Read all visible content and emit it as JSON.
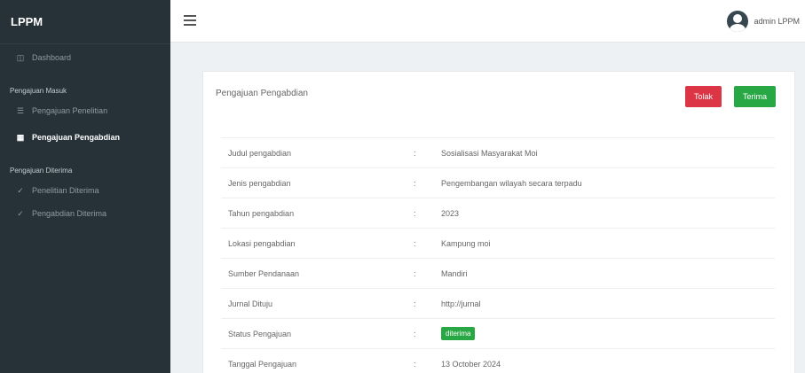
{
  "sidebar": {
    "brand": "LPPM",
    "dashboard": "Dashboard",
    "section_incoming": "Pengajuan Masuk",
    "item_research": "Pengajuan Penelitian",
    "item_service": "Pengajuan Pengabdian",
    "section_accepted": "Pengajuan Diterima",
    "item_research_accepted": "Penelitian Diterima",
    "item_service_accepted": "Pengabdian Diterima"
  },
  "header": {
    "user_name": "admin LPPM"
  },
  "card": {
    "title": "Pengajuan Pengabdian",
    "reject_label": "Tolak",
    "accept_label": "Terima",
    "separator": ":",
    "fields": [
      {
        "label": "Judul pengabdian",
        "value": "Sosialisasi Masyarakat Moi"
      },
      {
        "label": "Jenis pengabdian",
        "value": "Pengembangan wilayah secara terpadu"
      },
      {
        "label": "Tahun pengabdian",
        "value": "2023"
      },
      {
        "label": "Lokasi pengabdian",
        "value": "Kampung moi"
      },
      {
        "label": "Sumber Pendanaan",
        "value": "Mandiri"
      },
      {
        "label": "Jurnal Dituju",
        "value": "http://jurnal"
      },
      {
        "label": "Status Pengajuan",
        "value": "diterima"
      },
      {
        "label": "Tanggal Pengajuan",
        "value": "13 October 2024"
      }
    ]
  },
  "colors": {
    "sidebar_bg": "#263238",
    "reject": "#dc3545",
    "accept": "#28a745"
  }
}
